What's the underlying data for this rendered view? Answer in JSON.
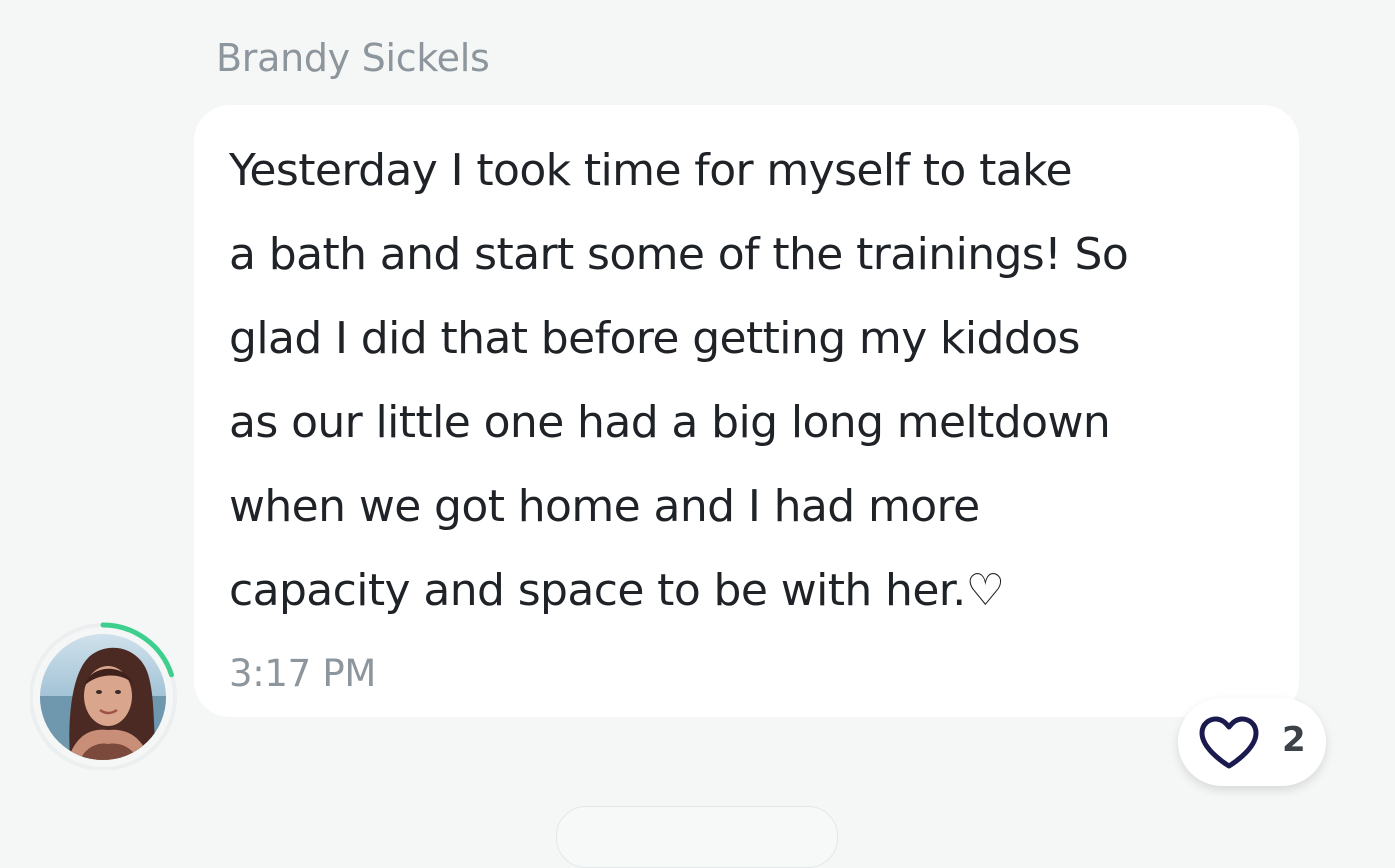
{
  "message": {
    "sender_name": "Brandy Sickels",
    "text_lines": [
      "Yesterday I took time for myself to take",
      "a bath and start some of the trainings! So",
      "glad I did that before getting my kiddos",
      "as our little one had a big long meltdown",
      "when we got home and I had more",
      "capacity and space to be with her.♡"
    ],
    "timestamp": "3:17 PM"
  },
  "avatar": {
    "icon": "user-photo-avatar",
    "progress_ring_fraction": 0.2,
    "progress_ring_color": "#3ecf8e"
  },
  "reaction": {
    "icon": "heart-icon",
    "count": "2",
    "icon_color": "#1a1a4e"
  },
  "colors": {
    "background": "#f5f7f7",
    "bubble": "#ffffff",
    "text": "#1f2328",
    "muted": "#8d969c"
  }
}
